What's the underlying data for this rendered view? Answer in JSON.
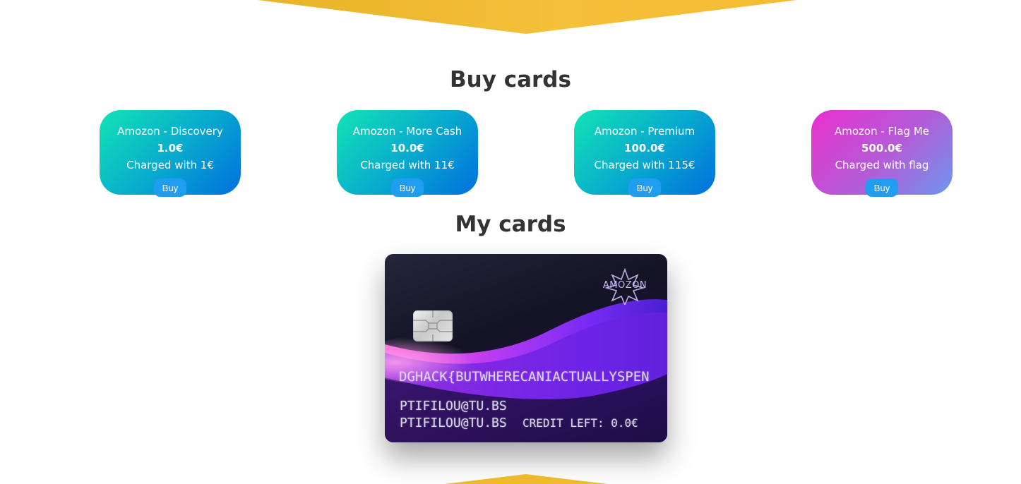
{
  "sections": {
    "buy_title": "Buy cards",
    "my_title": "My cards"
  },
  "offers": [
    {
      "name": "Amozon - Discovery",
      "price": "1.0€",
      "charge": "Charged with 1€",
      "button": "Buy",
      "style": "blue"
    },
    {
      "name": "Amozon - More Cash",
      "price": "10.0€",
      "charge": "Charged with 11€",
      "button": "Buy",
      "style": "blue"
    },
    {
      "name": "Amozon - Premium",
      "price": "100.0€",
      "charge": "Charged with 115€",
      "button": "Buy",
      "style": "blue"
    },
    {
      "name": "Amozon - Flag Me",
      "price": "500.0€",
      "charge": "Charged with flag",
      "button": "Buy",
      "style": "pink"
    }
  ],
  "card": {
    "logo_text": "AMOZON",
    "number": "DGHACK{BUTWHERECANIACTUALLYSPEN",
    "owner_line_1": "PTIFILOU@TU.BS",
    "owner_line_2": "PTIFILOU@TU.BS",
    "credit": "CREDIT LEFT: 0.0€"
  },
  "colors": {
    "blue_gradient": [
      "#12e3b4",
      "#08a7cf",
      "#0070dd"
    ],
    "pink_gradient": [
      "#ea2fcf",
      "#b15dd8",
      "#6e96ee"
    ],
    "buy_button": "#209cf0",
    "banner": "#f2b81c"
  }
}
